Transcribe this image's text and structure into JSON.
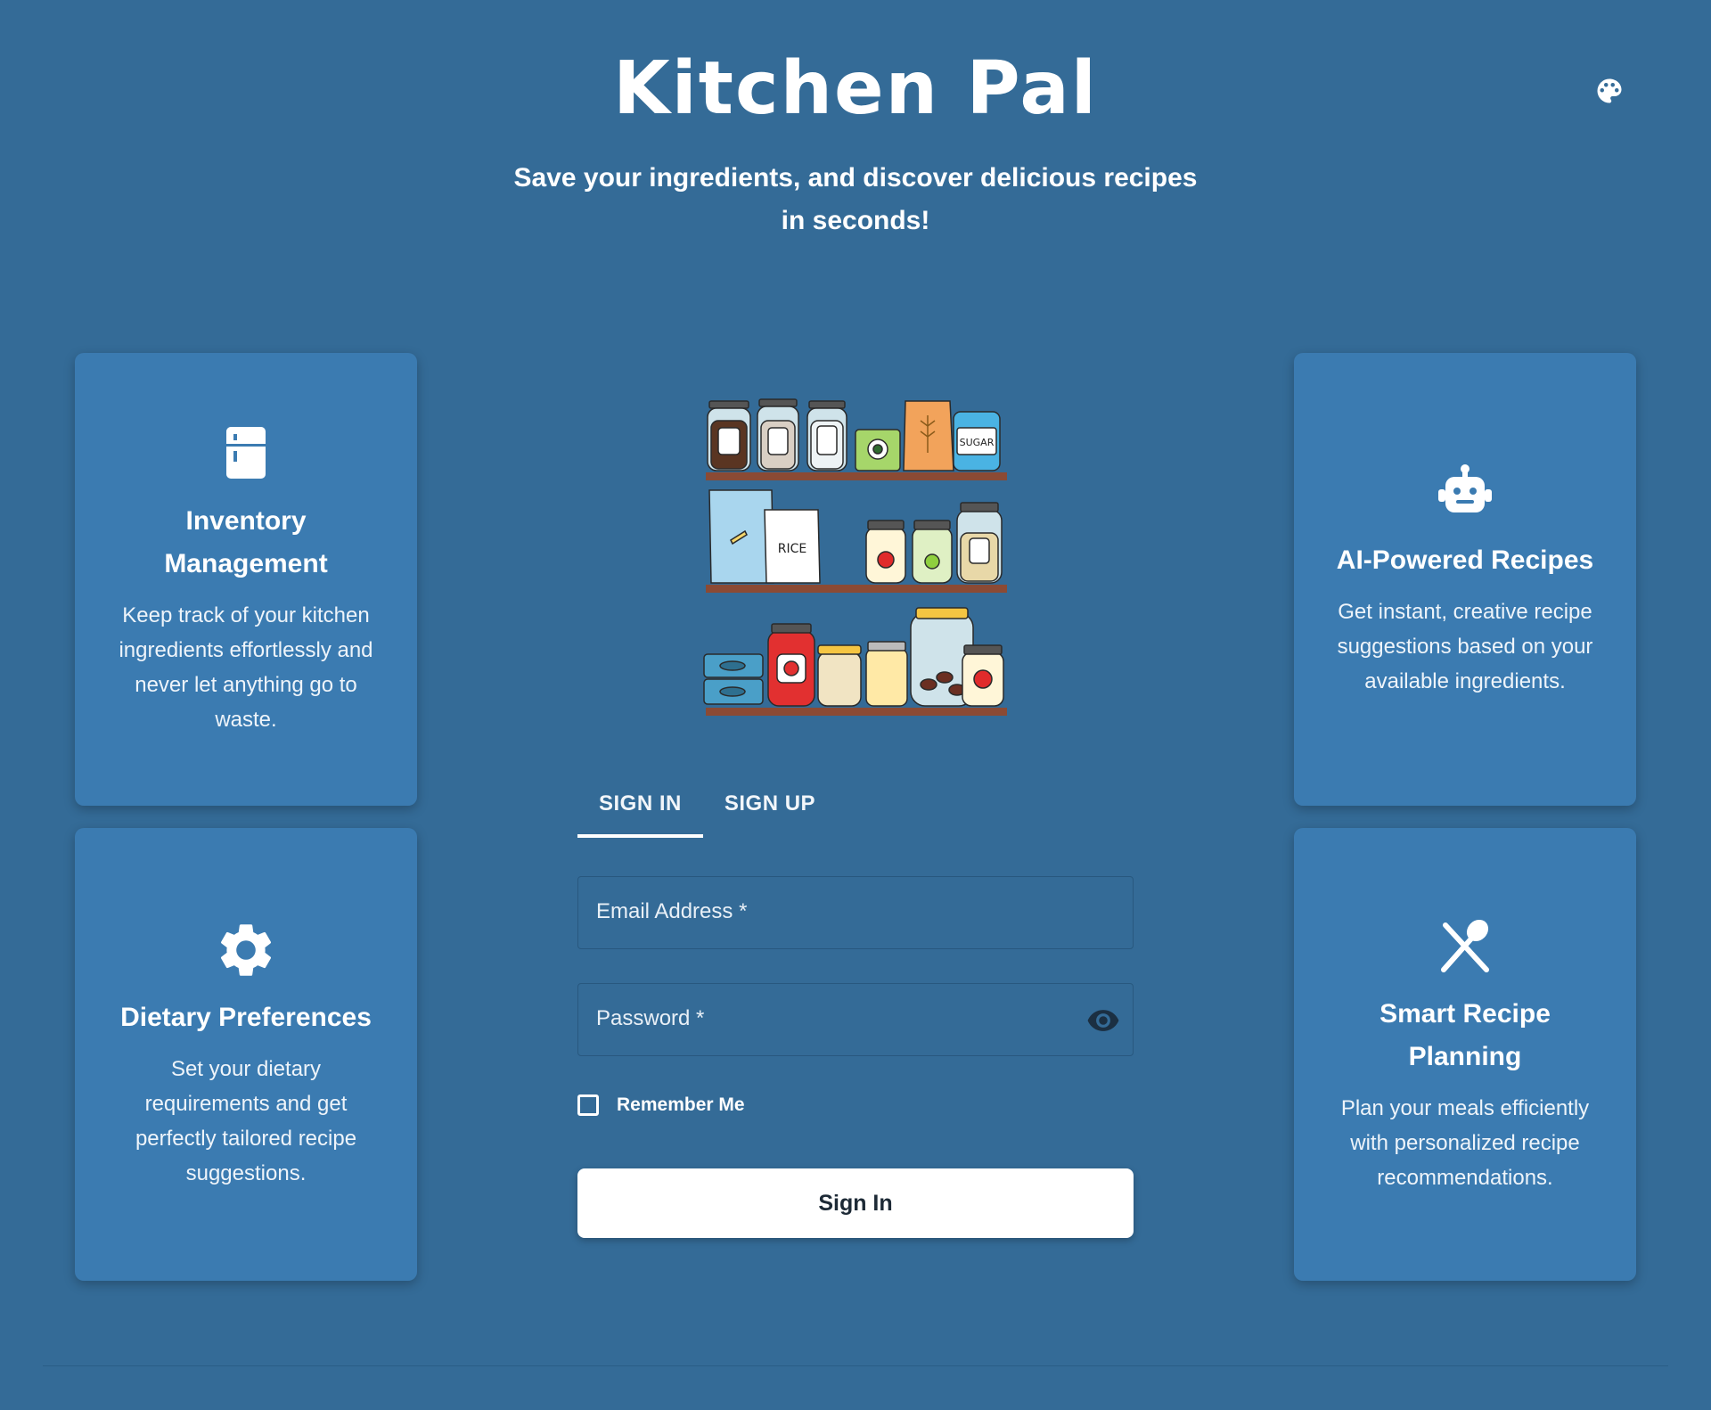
{
  "header": {
    "title": "Kitchen Pal",
    "subtitle": "Save your ingredients, and discover delicious recipes in seconds!",
    "theme_icon": "palette-icon"
  },
  "features": {
    "inventory": {
      "icon": "fridge-icon",
      "title": "Inventory Management",
      "description": "Keep track of your kitchen ingredients effortlessly and never let anything go to waste."
    },
    "dietary": {
      "icon": "gear-icon",
      "title": "Dietary Preferences",
      "description": "Set your dietary requirements and get perfectly tailored recipe suggestions."
    },
    "ai": {
      "icon": "robot-icon",
      "title": "AI-Powered Recipes",
      "description": "Get instant, creative recipe suggestions based on your available ingredients."
    },
    "smart": {
      "icon": "utensils-icon",
      "title": "Smart Recipe Planning",
      "description": "Plan your meals efficiently with personalized recipe recommendations."
    }
  },
  "illustration": {
    "rice_label": "RICE",
    "sugar_label": "SUGAR"
  },
  "auth": {
    "tabs": [
      {
        "label": "SIGN IN",
        "active": true
      },
      {
        "label": "SIGN UP",
        "active": false
      }
    ],
    "email_label": "Email Address *",
    "password_label": "Password *",
    "remember_label": "Remember Me",
    "remember_checked": false,
    "submit_label": "Sign In"
  },
  "colors": {
    "background": "#346b97",
    "card": "#3b7bb1",
    "shelf": "#8b4a34"
  }
}
